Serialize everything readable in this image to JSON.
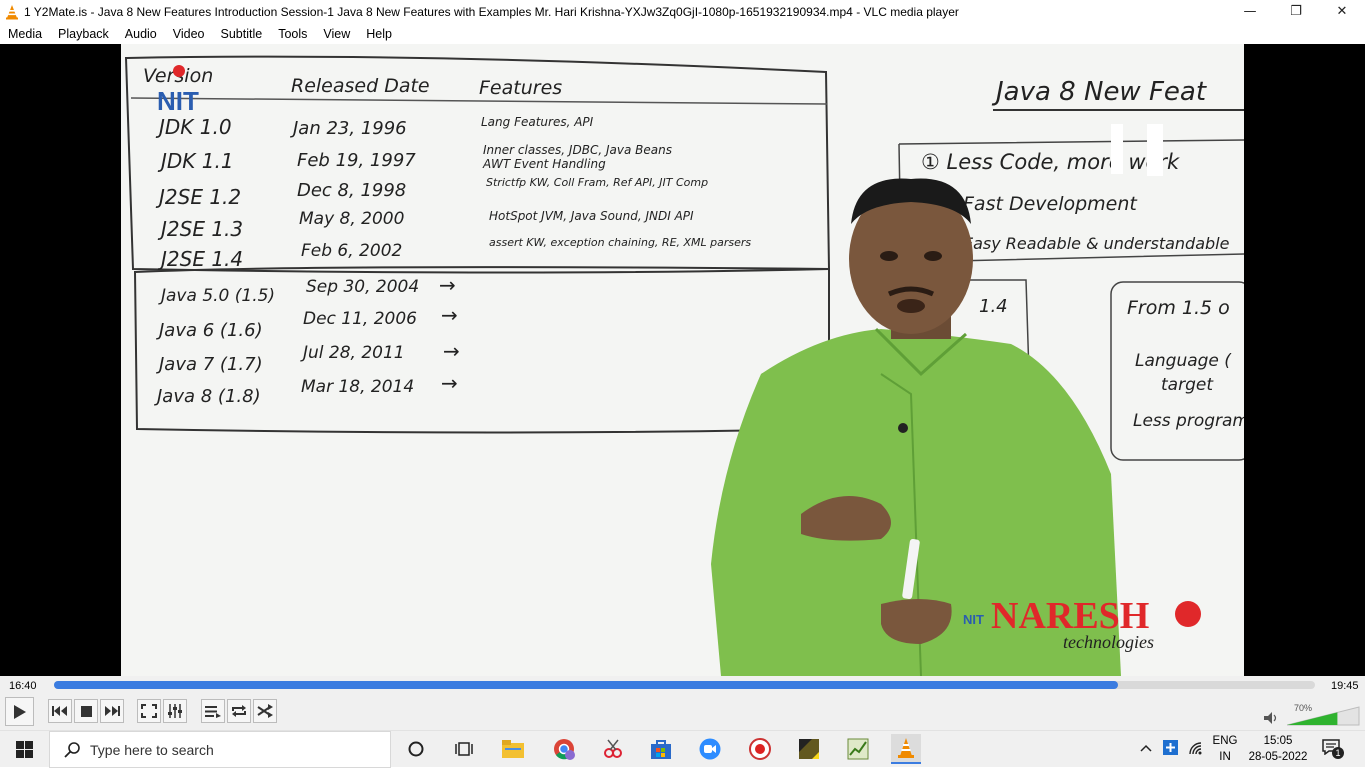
{
  "window": {
    "title": "1 Y2Mate.is - Java 8 New Features Introduction  Session-1  Java 8 New Features with Examples  Mr. Hari Krishna-YXJw3Zq0GjI-1080p-1651932190934.mp4 - VLC media player",
    "minimize": "—",
    "maximize": "❐",
    "close": "✕"
  },
  "menu": [
    "Media",
    "Playback",
    "Audio",
    "Video",
    "Subtitle",
    "Tools",
    "View",
    "Help"
  ],
  "board": {
    "headers": [
      "Version",
      "Released Date",
      "Features"
    ],
    "rows": [
      {
        "version": "JDK 1.0",
        "date": "Jan 23, 1996",
        "features": "Lang Features, API"
      },
      {
        "version": "JDK 1.1",
        "date": "Feb 19, 1997",
        "features": "Inner classes, JDBC, Java Beans",
        "features2": "AWT Event Handling"
      },
      {
        "version": "J2SE 1.2",
        "date": "Dec 8, 1998",
        "features": "Strictfp KW, Coll Fram, Ref API, JIT Comp"
      },
      {
        "version": "J2SE 1.3",
        "date": "May 8, 2000",
        "features": "HotSpot JVM, Java Sound, JNDI API"
      },
      {
        "version": "J2SE 1.4",
        "date": "Feb 6, 2002",
        "features": "assert KW, exception chaining, RE, XML parsers"
      },
      {
        "version": "Java 5.0 (1.5)",
        "date": "Sep 30, 2004",
        "features": "→"
      },
      {
        "version": "Java 6 (1.6)",
        "date": "Dec 11, 2006",
        "features": "→"
      },
      {
        "version": "Java 7 (1.7)",
        "date": "Jul 28, 2011",
        "features": "→"
      },
      {
        "version": "Java 8 (1.8)",
        "date": "Mar 18, 2014",
        "features": "→"
      }
    ],
    "right_title": "Java 8 New Feat",
    "points": [
      "① Less Code, more work",
      "Fast Development",
      "Easy Readable & understandable"
    ],
    "box_small": "1.4",
    "box_right": [
      "From 1.5 o",
      "Language (",
      "target",
      "Less program"
    ]
  },
  "watermark": {
    "brand": "NARESH",
    "sub": "technologies",
    "logo": "NIT"
  },
  "player": {
    "elapsed": "16:40",
    "total": "19:45",
    "progress": 0.844,
    "volume_label": "70%",
    "volume": 0.7
  },
  "taskbar": {
    "search_placeholder": "Type here to search",
    "lang_top": "ENG",
    "lang_bottom": "IN",
    "time": "15:05",
    "date": "28-05-2022",
    "notifications": "1"
  },
  "colors": {
    "accent": "#3b7ce0",
    "vlc_orange": "#f08a00",
    "brand_red": "#e0282a"
  }
}
